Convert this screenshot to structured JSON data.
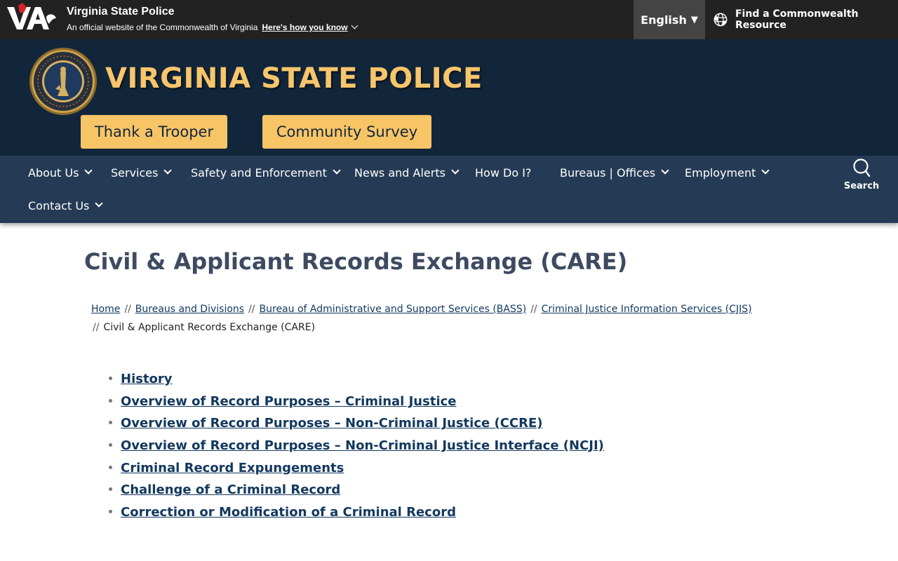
{
  "topbar": {
    "site_name": "Virginia State Police",
    "official_text": "An official website of the Commonwealth of Virginia",
    "how_you_know": "Here's how you know",
    "language": "English",
    "language_caret": "▼",
    "resource_link": "Find a Commonwealth Resource"
  },
  "header": {
    "agency_title": "VIRGINIA STATE POLICE",
    "buttons": [
      "Thank a Trooper",
      "Community Survey"
    ]
  },
  "nav": {
    "items": [
      {
        "label": "About Us",
        "dropdown": true
      },
      {
        "label": "Services",
        "dropdown": true
      },
      {
        "label": "Safety and Enforcement",
        "dropdown": true
      },
      {
        "label": "News and Alerts",
        "dropdown": true
      },
      {
        "label": "How Do I?",
        "dropdown": false
      },
      {
        "label": "Bureaus | Offices",
        "dropdown": true
      },
      {
        "label": "Employment",
        "dropdown": true
      },
      {
        "label": "Contact Us",
        "dropdown": true
      }
    ],
    "search_label": "Search"
  },
  "page": {
    "title": "Civil & Applicant Records Exchange (CARE)",
    "breadcrumb": [
      "Home",
      "Bureaus and Divisions",
      "Bureau of Administrative and Support Services (BASS)",
      "Criminal Justice Information Services (CJIS)"
    ],
    "breadcrumb_separator": "//",
    "breadcrumb_current": "Civil & Applicant Records Exchange (CARE)",
    "links": [
      "History",
      "Overview of Record Purposes – Criminal Justice",
      "Overview of Record Purposes – Non-Criminal Justice (CCRE)",
      "Overview of Record Purposes – Non-Criminal Justice Interface (NCJI)",
      "Criminal Record Expungements",
      "Challenge of a Criminal Record",
      "Correction or Modification of a Criminal Record"
    ]
  },
  "colors": {
    "topbar_bg": "#222222",
    "header_bg": "#12263b",
    "nav_bg": "#253b55",
    "gold_accent": "#f8c566",
    "link_color": "#12385e",
    "title_color": "#3e4a60"
  }
}
